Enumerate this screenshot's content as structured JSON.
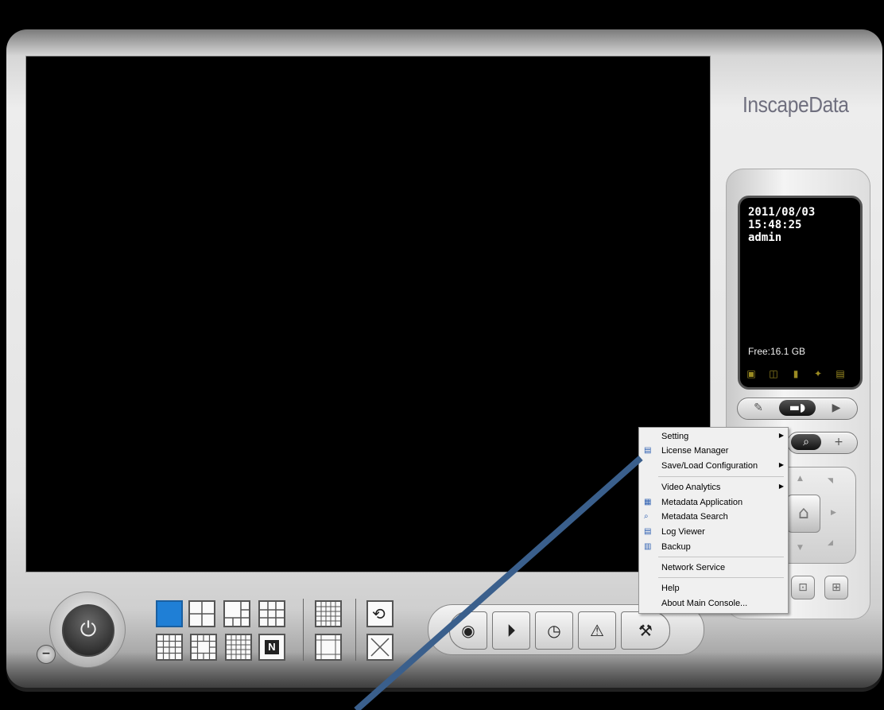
{
  "app": {
    "logo_text": "InscapeData"
  },
  "info_panel": {
    "date": "2011/08/03",
    "time": "15:48:25",
    "user": "admin",
    "free_space": "Free:16.1 GB",
    "status_icons": [
      "monitor-icon",
      "speaker-icon",
      "microphone-icon",
      "satellite-icon",
      "network-icon"
    ]
  },
  "right_controls": {
    "row1": [
      "wrench-icon",
      "camera-icon",
      "play-icon"
    ],
    "row2": [
      "search-icon",
      "plus-icon"
    ]
  },
  "context_menu": {
    "items": [
      {
        "label": "Setting",
        "has_submenu": true,
        "icon": ""
      },
      {
        "label": "License Manager",
        "has_submenu": false,
        "icon": "license-icon"
      },
      {
        "label": "Save/Load Configuration",
        "has_submenu": true,
        "icon": ""
      },
      {
        "label": "Video Analytics",
        "has_submenu": true,
        "icon": ""
      },
      {
        "label": "Metadata Application",
        "has_submenu": false,
        "icon": "metadata-app-icon"
      },
      {
        "label": "Metadata Search",
        "has_submenu": false,
        "icon": "metadata-search-icon"
      },
      {
        "label": "Log Viewer",
        "has_submenu": false,
        "icon": "log-icon"
      },
      {
        "label": "Backup",
        "has_submenu": false,
        "icon": "backup-icon"
      },
      {
        "label": "Network Service",
        "has_submenu": false,
        "icon": ""
      },
      {
        "label": "Help",
        "has_submenu": false,
        "icon": ""
      },
      {
        "label": "About Main Console...",
        "has_submenu": false,
        "icon": ""
      }
    ]
  },
  "layouts": {
    "top_row": [
      "1x1",
      "2x2",
      "1+5",
      "3x3"
    ],
    "bottom_row": [
      "4x4",
      "1+12",
      "5x5",
      "N"
    ],
    "n_label": "N"
  },
  "bottom_toolbar": [
    "record-icon",
    "playback-icon",
    "schedule-icon",
    "alert-icon",
    "tools-icon"
  ],
  "colors": {
    "accent": "#1f7fd6",
    "arrow": "#3a5f8c",
    "status_icon": "#9b8b22"
  }
}
